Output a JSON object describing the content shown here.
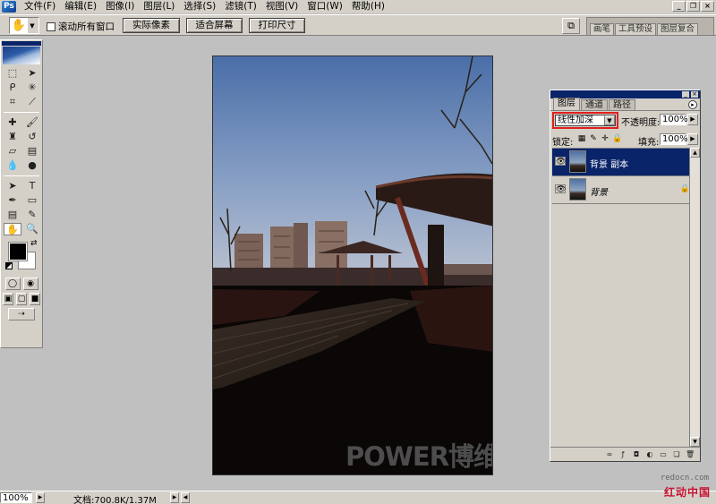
{
  "menu": {
    "items": [
      "文件(F)",
      "编辑(E)",
      "图像(I)",
      "图层(L)",
      "选择(S)",
      "滤镜(T)",
      "视图(V)",
      "窗口(W)",
      "帮助(H)"
    ]
  },
  "options": {
    "scroll_all_windows": "滚动所有窗口",
    "actual_pixels": "实际像素",
    "fit_screen": "适合屏幕",
    "print_size": "打印尺寸"
  },
  "palette_well": {
    "tabs": [
      "画笔",
      "工具预设",
      "图层复合"
    ]
  },
  "layers_panel": {
    "tabs": [
      "图层",
      "通道",
      "路径"
    ],
    "blend_mode": "线性加深",
    "opacity_label": "不透明度:",
    "opacity": "100%",
    "lock_label": "锁定:",
    "fill_label": "填充:",
    "fill": "100%",
    "layers": [
      {
        "name": "背景 副本",
        "selected": true,
        "visible": true,
        "locked": false
      },
      {
        "name": "背景",
        "selected": false,
        "visible": true,
        "locked": true
      }
    ]
  },
  "document": {
    "watermark": "POWER博维"
  },
  "status": {
    "zoom": "100%",
    "doc_info": "文档:700.8K/1.37M"
  },
  "site": {
    "url": "redocn.com",
    "name": "红动中国"
  },
  "colors": {
    "foreground": "#000000",
    "background": "#ffffff",
    "selection": "#0a246a",
    "highlight_box": "#e31e1e"
  }
}
